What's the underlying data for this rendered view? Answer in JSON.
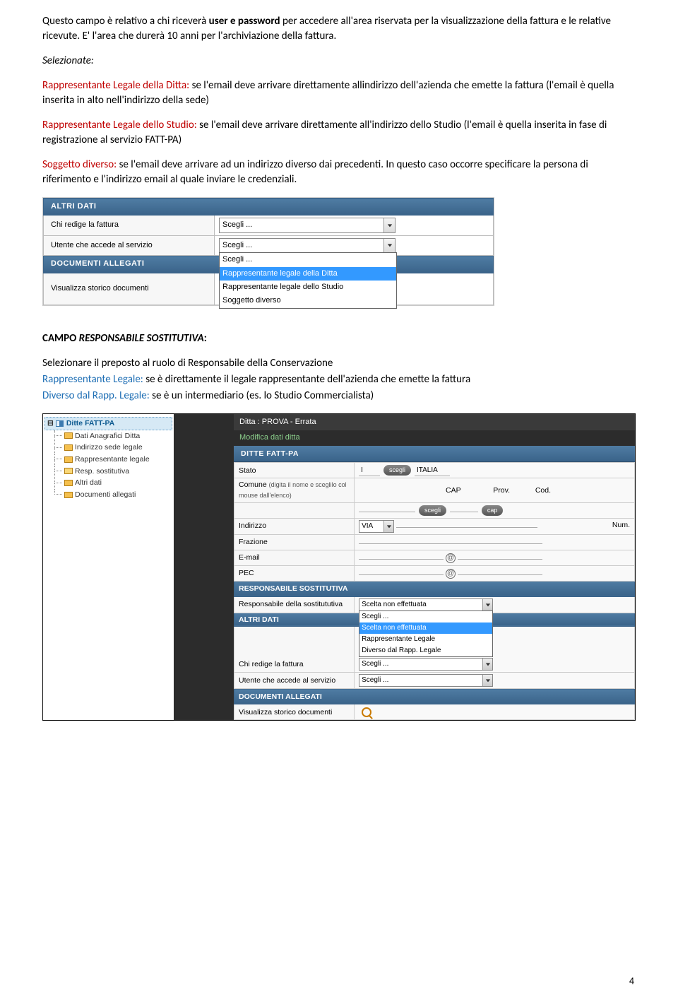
{
  "para1": {
    "t1": "Questo campo è relativo a chi riceverà ",
    "b1": "user e password",
    "t2": " per accedere all'area riservata per la visualizzazione della fattura e le relative ricevute. E' l'area che durerà 10 anni per l'archiviazione della fattura."
  },
  "para2": "Selezionate:",
  "p3": {
    "lead": "Rappresentante Legale della Ditta:",
    "rest": " se l'email deve arrivare direttamente allindirizzo dell'azienda che emette la fattura (l'email è quella inserita in alto nell'indirizzo della sede)"
  },
  "p4": {
    "lead": "Rappresentante Legale dello Studio:",
    "rest": " se l'email deve arrivare direttamente all'indirizzo dello Studio (l'email è quella inserita in fase di registrazione al servizio FATT-PA)"
  },
  "p5": {
    "lead": "Soggetto diverso:",
    "mid": " se l'email deve arrivare ad un indirizzo diverso dai precedenti. In questo caso occorre specificare la persona di riferimento e l'indirizzo email al quale inviare le credenziali."
  },
  "shot1": {
    "hdr1": "ALTRI DATI",
    "row1": "Chi redige la fattura",
    "row1val": "Scegli ...",
    "row2": "Utente che accede al servizio",
    "row2val": "Scegli ...",
    "dd": [
      "Scegli ...",
      "Rappresentante legale della Ditta",
      "Rappresentante legale dello Studio",
      "Soggetto diverso"
    ],
    "hdr2": "DOCUMENTI ALLEGATI",
    "row3": "Visualizza storico documenti"
  },
  "campo": {
    "title_pre": "CAMPO ",
    "title_i": "RESPONSABILE SOSTITUTIVA",
    "title_post": ":",
    "line1": "Selezionare il preposto al ruolo di Responsabile della Conservazione",
    "l2a": "Rappresentante Legale:",
    "l2b": "  se è direttamente il legale rappresentante dell'azienda che emette la fattura",
    "l3a": "Diverso dal Rapp. Legale:",
    "l3b": " se è un intermediario (es. lo Studio Commercialista)"
  },
  "shot2": {
    "treeRoot": "Ditte FATT-PA",
    "treeItems": [
      "Dati Anagrafici Ditta",
      "Indirizzo sede legale",
      "Rappresentante legale",
      "Resp. sostitutiva",
      "Altri dati",
      "Documenti allegati"
    ],
    "title": "Ditta : PROVA - Errata",
    "subtitle": "Modifica dati ditta",
    "tab": "DITTE FATT-PA",
    "r_stato": "Stato",
    "r_stato_val": "I",
    "r_stato_btn": "scegli",
    "r_stato_country": "ITALIA",
    "r_comune": "Comune",
    "r_comune_hint": "(digita il nome e sceglilo col mouse dall'elenco)",
    "r_cap": "CAP",
    "r_prov": "Prov.",
    "r_cod": "Cod.",
    "r_comune_btn": "scegli",
    "r_cap_btn": "cap",
    "r_indirizzo": "Indirizzo",
    "r_via": "VIA",
    "r_num": "Num.",
    "r_frazione": "Frazione",
    "r_email": "E-mail",
    "r_pec": "PEC",
    "sec_resp": "RESPONSABILE SOSTITUTIVA",
    "r_resp": "Responsabile della sostitututiva",
    "r_resp_val": "Scelta non effettuata",
    "dd_resp": [
      "Scegli ...",
      "Scelta non effettuata",
      "Rappresentante Legale",
      "Diverso dal Rapp. Legale"
    ],
    "sec_altri": "ALTRI DATI",
    "r_chi": "Chi redige la fattura",
    "r_utente": "Utente che accede al servizio",
    "r_scegli": "Scegli ...",
    "sec_doc": "DOCUMENTI ALLEGATI",
    "r_vis": "Visualizza storico documenti"
  },
  "pageNum": "4"
}
